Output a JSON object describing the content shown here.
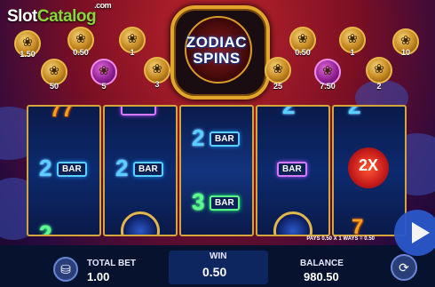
{
  "watermark": {
    "part1": "Slot",
    "part2": "Catalog",
    "suffix": ".com"
  },
  "game": {
    "title_line1": "ZODIAC",
    "title_line2": "SPINS"
  },
  "prizes_left": [
    {
      "value": "1.50",
      "icon": "zodiac-animal-icon"
    },
    {
      "value": "0.50",
      "icon": "zodiac-animal-icon"
    },
    {
      "value": "1",
      "icon": "zodiac-animal-icon"
    },
    {
      "value": "50",
      "icon": "zodiac-animal-icon"
    },
    {
      "value": "5",
      "icon": "zodiac-animal-icon"
    },
    {
      "value": "3",
      "icon": "zodiac-animal-icon"
    }
  ],
  "prizes_right": [
    {
      "value": "0.50",
      "icon": "zodiac-animal-icon"
    },
    {
      "value": "1",
      "icon": "zodiac-animal-icon"
    },
    {
      "value": "10",
      "icon": "zodiac-animal-icon"
    },
    {
      "value": "25",
      "icon": "zodiac-animal-icon"
    },
    {
      "value": "7.50",
      "icon": "zodiac-animal-icon"
    },
    {
      "value": "2",
      "icon": "zodiac-animal-icon"
    }
  ],
  "reels": {
    "bar_label": "BAR",
    "two": "2",
    "three": "3",
    "multiplier": "2X"
  },
  "info_line": "PAYS 0.50 X 1 WAYS = 0.50",
  "footer": {
    "total_bet_label": "TOTAL BET",
    "total_bet_value": "1.00",
    "win_label": "WIN",
    "win_value": "0.50",
    "balance_label": "BALANCE",
    "balance_value": "980.50"
  },
  "colors": {
    "accent_gold": "#e2a72a",
    "reel_frame": "#d4a53a",
    "play_button": "#2a57c8"
  }
}
